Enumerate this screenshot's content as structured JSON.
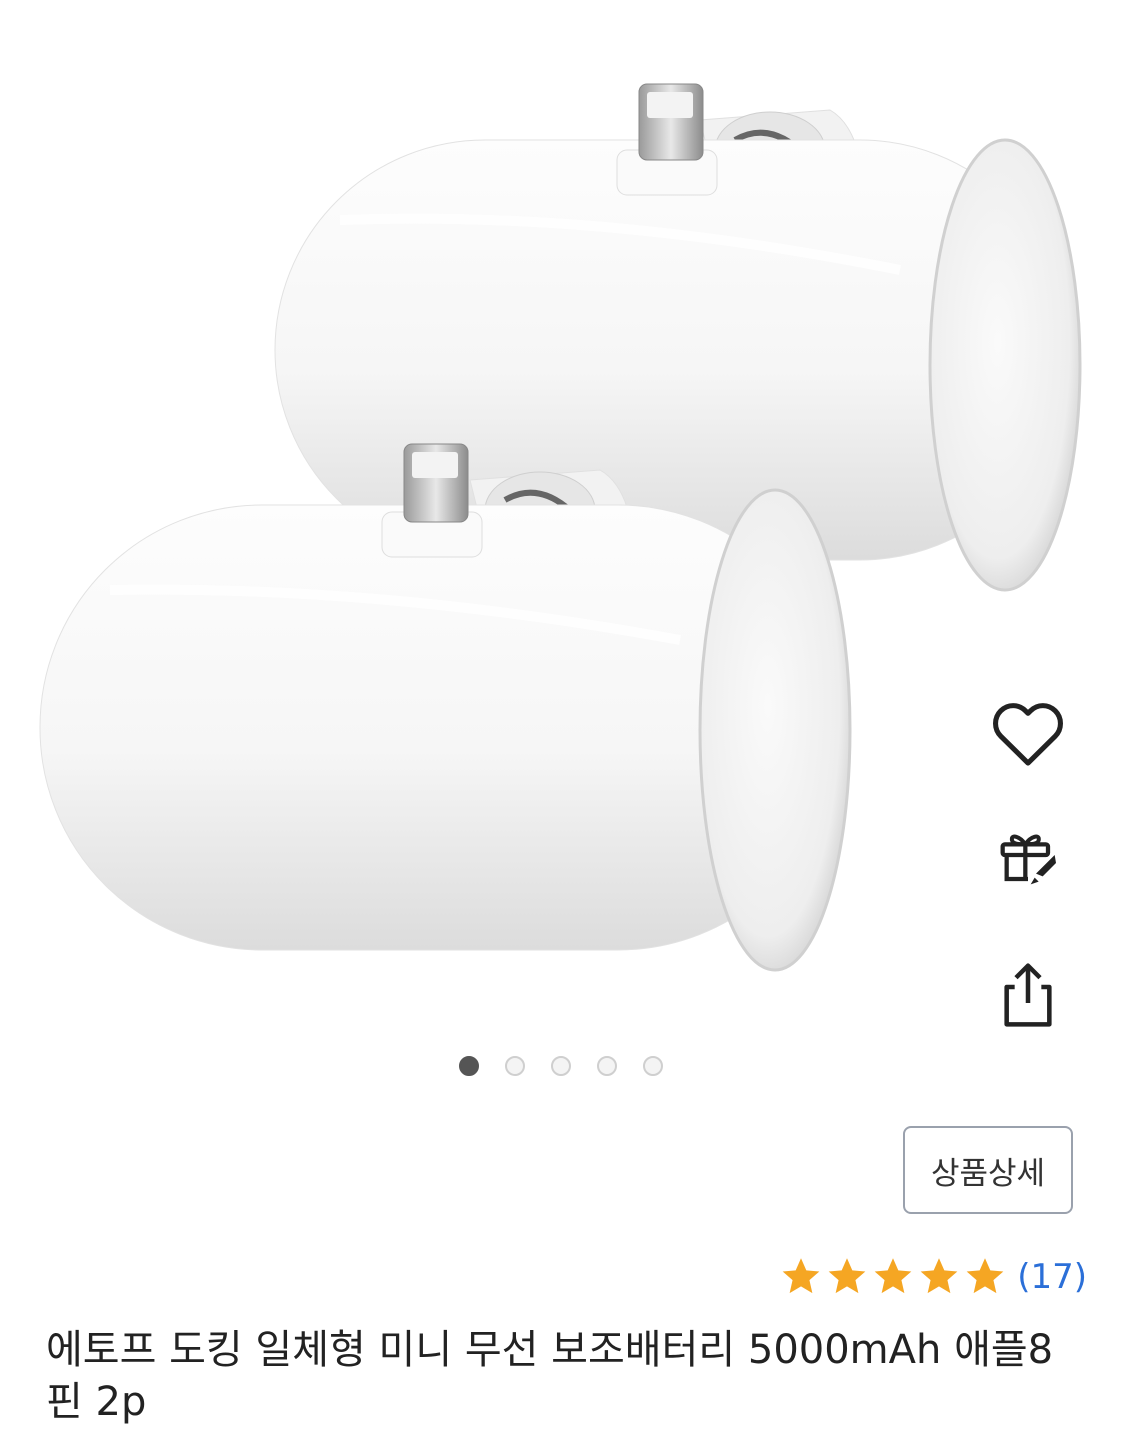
{
  "product": {
    "title": "에토프 도킹 일체형 미니 무선 보조배터리 5000mAh 애플8핀 2p",
    "detail_button_label": "상품상세",
    "review_count_text": "(17)",
    "rating": 5,
    "rating_max": 5,
    "star_color": "#f5a623",
    "link_color": "#2b6fd8"
  },
  "gallery": {
    "image_count": 5,
    "active_index": 0
  },
  "actions": {
    "items": [
      {
        "icon": "heart-icon"
      },
      {
        "icon": "gift-icon"
      },
      {
        "icon": "share-icon"
      }
    ]
  }
}
